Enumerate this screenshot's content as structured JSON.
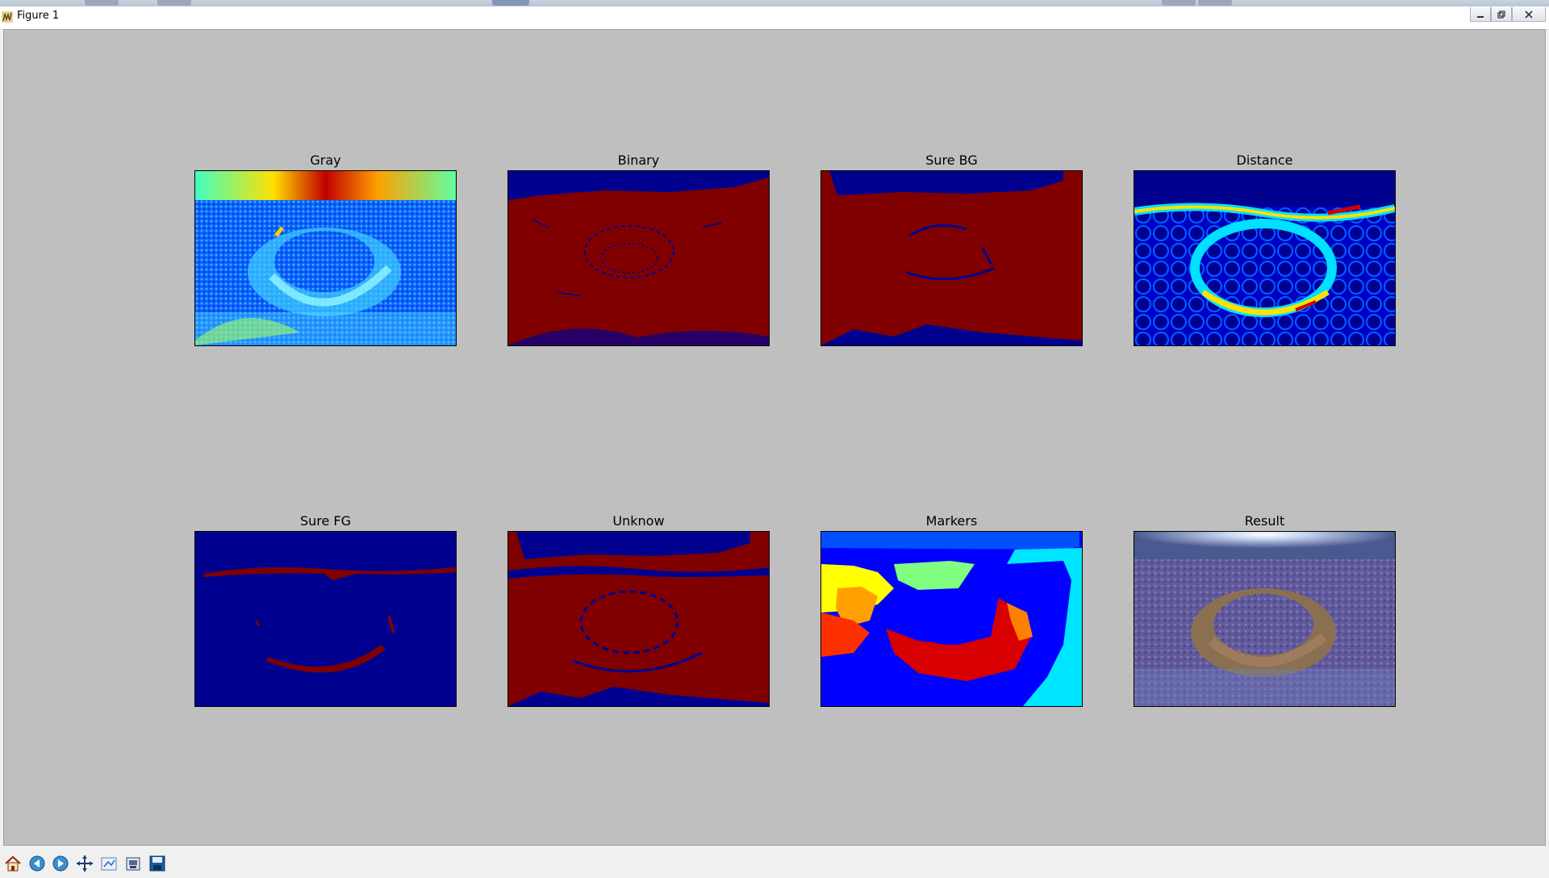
{
  "window": {
    "title": "Figure 1",
    "controls": [
      "minimize",
      "maximize",
      "close"
    ]
  },
  "subplots": [
    {
      "title": "Gray",
      "content": "jet-colormap grayscale image of Horseshoe Bend"
    },
    {
      "title": "Binary",
      "content": "binary threshold mask"
    },
    {
      "title": "Sure BG",
      "content": "dilated sure background mask"
    },
    {
      "title": "Distance",
      "content": "distance transform"
    },
    {
      "title": "Sure FG",
      "content": "sure foreground mask"
    },
    {
      "title": "Unknow",
      "content": "unknown region mask"
    },
    {
      "title": "Markers",
      "content": "watershed marker labels"
    },
    {
      "title": "Result",
      "content": "watershed result overlay"
    }
  ],
  "toolbar": {
    "buttons": [
      "home-icon",
      "back-icon",
      "forward-icon",
      "pan-icon",
      "subplots-config-icon",
      "zoom-rect-icon",
      "save-icon"
    ]
  },
  "colors": {
    "canvas_bg": "#bfbfbf",
    "jet_dark_blue": "#00008f",
    "jet_dark_red": "#800000",
    "jet_blue": "#0000ff",
    "jet_cyan": "#00e5ff",
    "jet_yellow": "#ffff00",
    "jet_red": "#d80000",
    "jet_orange": "#ff8000"
  }
}
